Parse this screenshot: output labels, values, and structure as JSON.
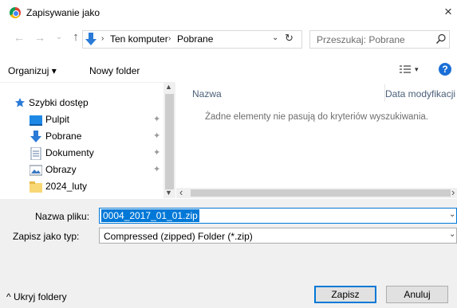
{
  "window": {
    "title": "Zapisywanie jako",
    "close_glyph": "×"
  },
  "address": {
    "back_glyph": "←",
    "forward_glyph": "→",
    "recent_glyph": "⌄",
    "up_glyph": "↑",
    "crumbs": [
      "Ten komputer",
      "Pobrane"
    ],
    "crumb_sep": "›",
    "dropdown_glyph": "⌄",
    "refresh_glyph": "↻",
    "search_placeholder": "Przeszukaj: Pobrane"
  },
  "toolbar": {
    "organize_label": "Organizuj ▾",
    "new_folder_label": "Nowy folder",
    "view_drop": "▾",
    "help_glyph": "?"
  },
  "nav": {
    "quick_access_label": "Szybki dostęp",
    "items": [
      {
        "label": "Pulpit",
        "icon": "desktop-icon",
        "pinned": true
      },
      {
        "label": "Pobrane",
        "icon": "download-icon",
        "pinned": true
      },
      {
        "label": "Dokumenty",
        "icon": "documents-icon",
        "pinned": true
      },
      {
        "label": "Obrazy",
        "icon": "pictures-icon",
        "pinned": true
      },
      {
        "label": "2024_luty",
        "icon": "folder-icon",
        "pinned": false
      }
    ],
    "pin_glyph": "📌"
  },
  "list": {
    "col_name": "Nazwa",
    "col_date": "Data modyfikacji",
    "empty_message": "Żadne elementy nie pasują do kryteriów wyszukiwania."
  },
  "form": {
    "filename_label": "Nazwa pliku:",
    "filename_value": "0004_2017_01_01.zip",
    "filetype_label": "Zapisz jako typ:",
    "filetype_value": "Compressed (zipped) Folder (*.zip)",
    "dropdown_glyph": "⌄"
  },
  "footer": {
    "hide_folders_label": "^  Ukryj foldery",
    "save_label": "Zapisz",
    "cancel_label": "Anuluj"
  },
  "colors": {
    "accent": "#0078d7",
    "help": "#1a6fd6",
    "quick_access_star": "#2a7bd7"
  }
}
